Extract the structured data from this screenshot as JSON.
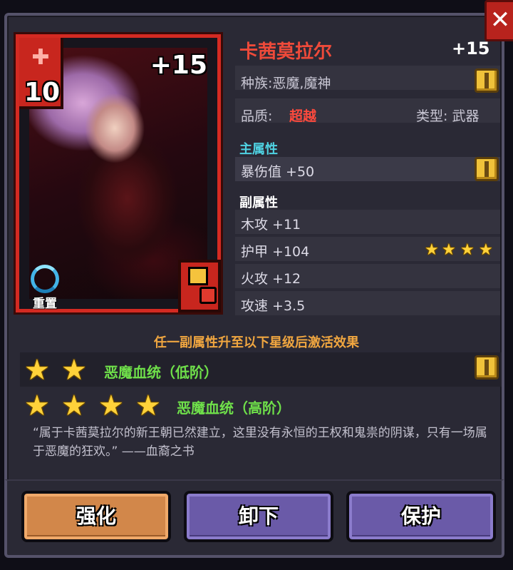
{
  "item": {
    "name": "卡茜莫拉尔",
    "enhance_level": "+15",
    "card_plus": "+15",
    "card_level": "10",
    "race": "种族:恶魔,魔神",
    "quality_label": "品质:",
    "quality_value": "超越",
    "type_label": "类型: 武器"
  },
  "card": {
    "reset_label": "重置",
    "sword_icon": "✚"
  },
  "main_attr": {
    "title": "主属性",
    "value": "暴伤值 +50"
  },
  "sub_attr": {
    "title": "副属性",
    "items": [
      {
        "label": "木攻 +11",
        "stars": 0
      },
      {
        "label": "护甲 +104",
        "stars": 4
      },
      {
        "label": "火攻 +12",
        "stars": 0
      },
      {
        "label": "攻速 +3.5",
        "stars": 0
      }
    ]
  },
  "set_effects": {
    "title": "任一副属性升至以下星级后激活效果",
    "effects": [
      {
        "stars": 2,
        "name": "恶魔血统（低阶）"
      },
      {
        "stars": 4,
        "name": "恶魔血统（高阶）"
      }
    ]
  },
  "flavor_text": "“属于卡茜莫拉尔的新王朝已然建立，这里没有永恒的王权和鬼祟的阴谋，只有一场属于恶魔的狂欢。” ——血裔之书",
  "buttons": {
    "enhance": "强化",
    "unequip": "卸下",
    "protect": "保护"
  },
  "close_label": "✕",
  "colors": {
    "name": "#ee4a3a",
    "quality": "#ff4a3d",
    "main_attr_title": "#4fd2e2",
    "effect_title": "#f0a640",
    "effect_name": "#6fe04a",
    "star": "#ffd23a"
  }
}
